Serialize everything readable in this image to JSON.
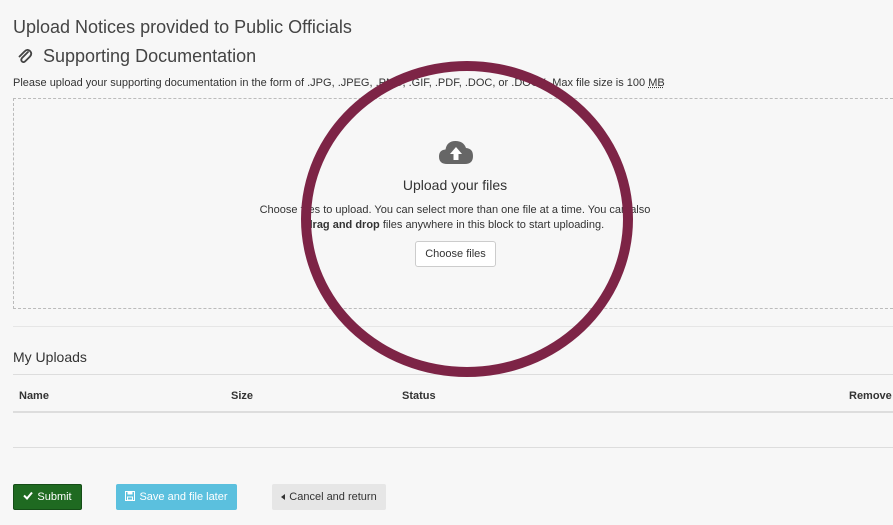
{
  "page": {
    "title": "Upload Notices provided to Public Officials",
    "section_title": "Supporting Documentation",
    "help_text_prefix": "Please upload your supporting documentation in the form of .JPG, .JPEG, .PNG, .GIF, .PDF, .DOC, or .DOCX. Max file size is 100 ",
    "help_text_unit": "MB"
  },
  "dropzone": {
    "icon": "cloud-upload-icon",
    "title": "Upload your files",
    "text_line1": "Choose files to upload. You can select more than one file at a time. You can also",
    "text_drag_bold": "drag and drop",
    "text_line2_rest": " files anywhere in this block to start uploading.",
    "choose_button": "Choose files"
  },
  "uploads": {
    "title": "My Uploads",
    "columns": [
      "Name",
      "Size",
      "Status",
      "Remove"
    ]
  },
  "actions": {
    "submit": "Submit",
    "save": "Save and file later",
    "cancel": "Cancel and return"
  },
  "colors": {
    "annotation_circle": "#7d2446",
    "submit_bg": "#1f6a21",
    "save_bg": "#5bc0de",
    "cancel_bg": "#e6e6e6"
  }
}
